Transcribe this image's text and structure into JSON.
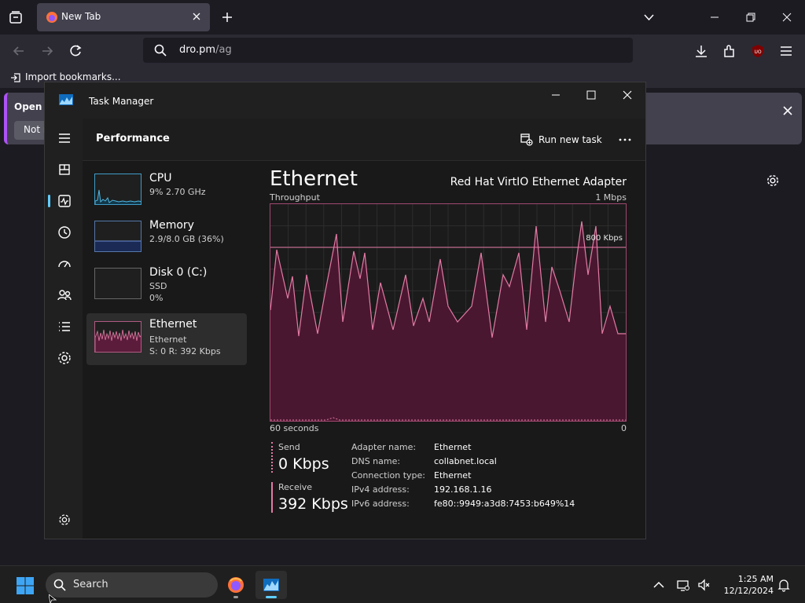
{
  "browser": {
    "tab_title": "New Tab",
    "url_host": "dro.pm",
    "url_path": "/ag",
    "import_bookmarks": "Import bookmarks...",
    "notice_title": "Open F",
    "notice_button": "Not n",
    "extension_badge": "UO"
  },
  "task_manager": {
    "window_title": "Task Manager",
    "section_title": "Performance",
    "run_new_task": "Run new task",
    "performance_items": [
      {
        "name": "CPU",
        "line1": "9% 2.70 GHz",
        "line2": ""
      },
      {
        "name": "Memory",
        "line1": "2.9/8.0 GB (36%)",
        "line2": ""
      },
      {
        "name": "Disk 0 (C:)",
        "line1": "SSD",
        "line2": "0%"
      },
      {
        "name": "Ethernet",
        "line1": "Ethernet",
        "line2": "S: 0 R: 392 Kbps"
      }
    ],
    "detail": {
      "title": "Ethernet",
      "adapter": "Red Hat VirtIO Ethernet Adapter",
      "graph_label": "Throughput",
      "graph_max": "1 Mbps",
      "graph_ref": "800 Kbps",
      "time_span": "60 seconds",
      "time_end": "0",
      "send_label": "Send",
      "send_value": "0 Kbps",
      "receive_label": "Receive",
      "receive_value": "392 Kbps",
      "info": [
        {
          "key": "Adapter name:",
          "value": "Ethernet"
        },
        {
          "key": "DNS name:",
          "value": "collabnet.local"
        },
        {
          "key": "Connection type:",
          "value": "Ethernet"
        },
        {
          "key": "IPv4 address:",
          "value": "192.168.1.16"
        },
        {
          "key": "IPv6 address:",
          "value": "fe80::9949:a3d8:7453:b649%14"
        }
      ]
    }
  },
  "taskbar": {
    "search_placeholder": "Search",
    "time": "1:25 AM",
    "date": "12/12/2024"
  },
  "colors": {
    "accent": "#60cdff",
    "graph_line": "#e37aa5",
    "graph_fill": "#4a1730",
    "firefox_accent": "#ad52f5"
  }
}
